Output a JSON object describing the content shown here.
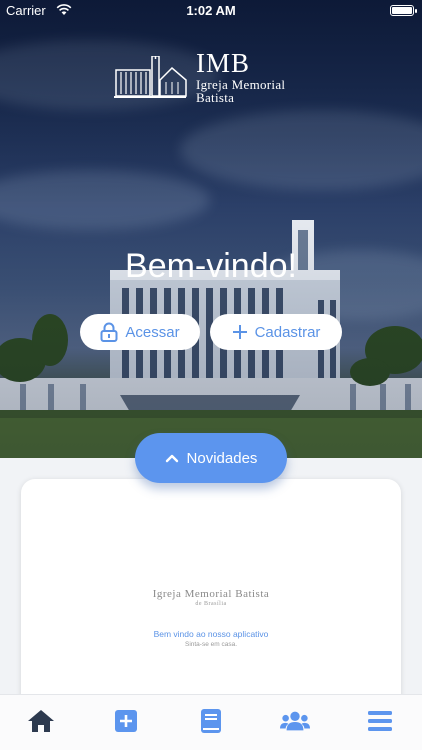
{
  "status": {
    "carrier": "Carrier",
    "time": "1:02 AM"
  },
  "logo": {
    "title": "IMB",
    "line1": "Igreja Memorial",
    "line2": "Batista"
  },
  "hero": {
    "welcome": "Bem-vindo!"
  },
  "buttons": {
    "login": "Acessar",
    "signup": "Cadastrar"
  },
  "news": {
    "label": "Novidades"
  },
  "card": {
    "brand": "Igreja Memorial Batista",
    "brand_sub": "de Brasília",
    "welcome": "Bem vindo ao nosso aplicativo",
    "tagline": "Sinta-se em casa."
  },
  "colors": {
    "accent": "#5c95ee",
    "tab_icon": "#5c95ee",
    "tab_home": "#2d3a4f"
  },
  "tabs": [
    "home-icon",
    "plus-icon",
    "book-icon",
    "people-icon",
    "menu-icon"
  ]
}
